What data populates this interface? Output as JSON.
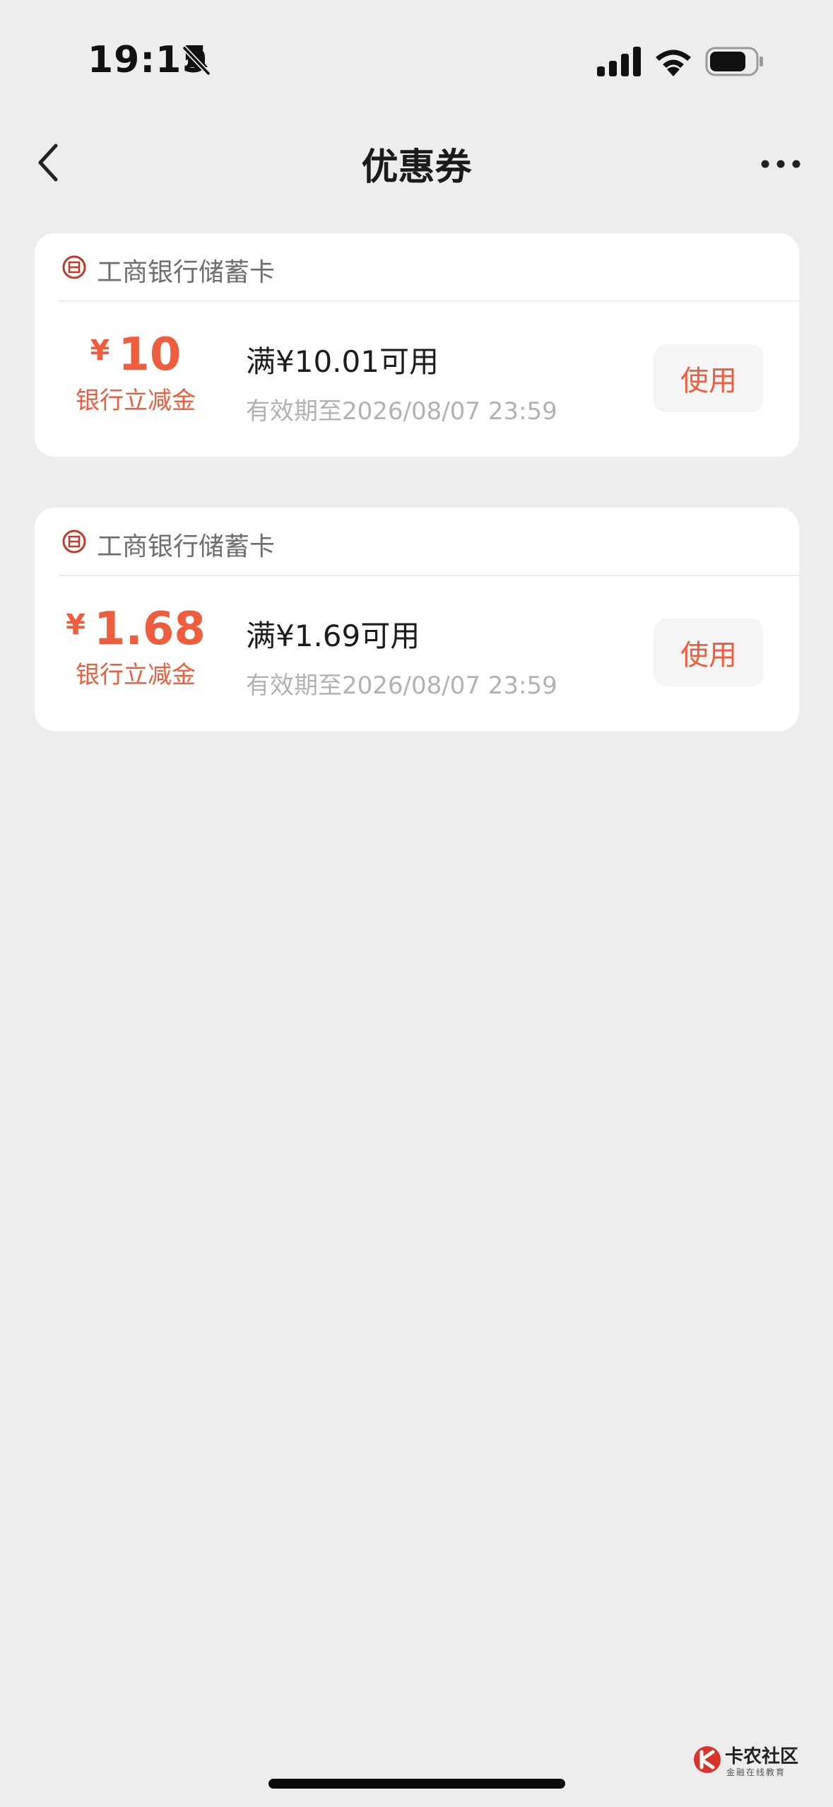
{
  "status_bar": {
    "time": "19:15",
    "icons": [
      "bell-slash-icon",
      "cellular-signal-icon",
      "wifi-icon",
      "battery-icon"
    ]
  },
  "nav": {
    "title": "优惠券",
    "back_icon": "chevron-left-icon",
    "more_icon": "more-dots-icon"
  },
  "coupons": [
    {
      "bank_name": "工商银行储蓄卡",
      "currency": "¥",
      "amount": "10",
      "amount_label": "银行立减金",
      "condition": "满¥10.01可用",
      "expiry": "有效期至2026/08/07 23:59",
      "button_label": "使用"
    },
    {
      "bank_name": "工商银行储蓄卡",
      "currency": "¥",
      "amount": "1.68",
      "amount_label": "银行立减金",
      "condition": "满¥1.69可用",
      "expiry": "有效期至2026/08/07 23:59",
      "button_label": "使用"
    }
  ],
  "watermark": {
    "title": "卡农社区",
    "subtitle": "金融在线教育"
  },
  "colors": {
    "background": "#ededed",
    "accent": "#ee5d3e",
    "card": "#ffffff",
    "bank_logo": "#c0392b"
  }
}
